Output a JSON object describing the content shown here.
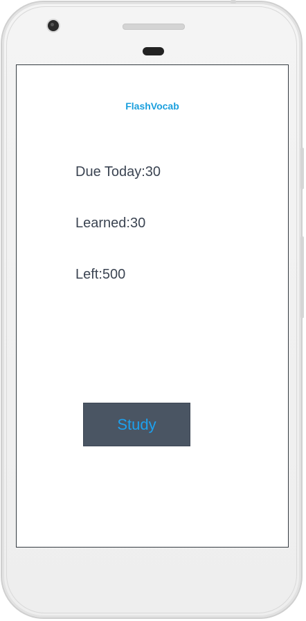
{
  "app": {
    "title": "FlashVocab"
  },
  "stats": {
    "due_today": "Due Today:30",
    "learned": "Learned:30",
    "left": "Left:500"
  },
  "actions": {
    "study_label": "Study"
  },
  "colors": {
    "accent": "#1a9fdd",
    "button_bg": "#4a5563",
    "text": "#3b4452"
  }
}
